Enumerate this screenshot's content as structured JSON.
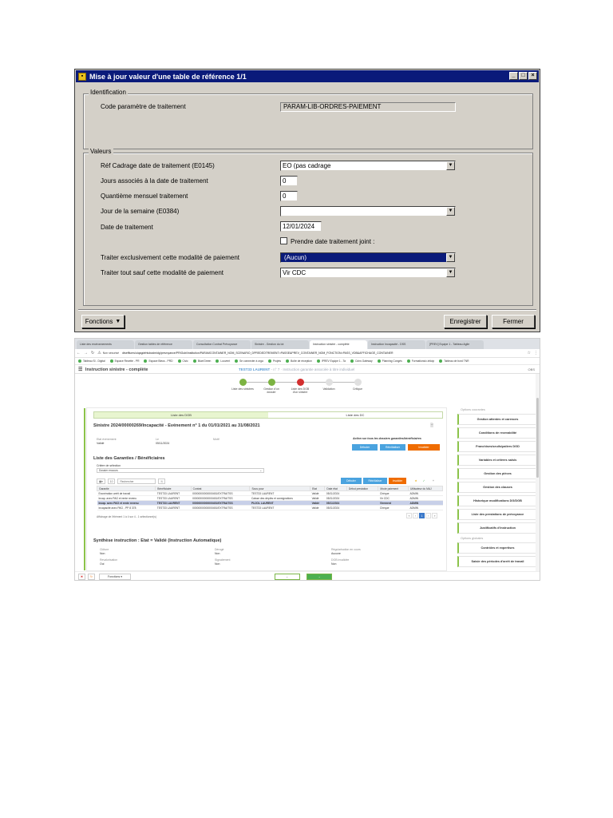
{
  "dialog": {
    "title": "Mise à jour valeur d'une table de référence 1/1",
    "controls": [
      "_",
      "□",
      "×"
    ],
    "identification": {
      "legend": "Identification",
      "code_label": "Code paramètre de traitement",
      "code_value": "PARAM-LIB-ORDRES-PAIEMENT"
    },
    "valeurs": {
      "legend": "Valeurs",
      "fields": [
        {
          "label": "Réf Cadrage date de traitement (E0145)",
          "value": "EO (pas cadrage",
          "kind": "combo"
        },
        {
          "label": "Jours associés à la date de traitement",
          "value": "0",
          "kind": "input"
        },
        {
          "label": "Quantième mensuel traitement",
          "value": "0",
          "kind": "input"
        },
        {
          "label": "Jour de la semaine (E0384)",
          "value": "",
          "kind": "combo"
        },
        {
          "label": "Date de traitement",
          "value": "12/01/2024",
          "kind": "input"
        }
      ],
      "checkbox_label": "Prendre date traitement joint :",
      "modalite_excl_label": "Traiter exclusivement cette modalité de paiement",
      "modalite_excl_value": "(Aucun)",
      "modalite_sauf_label": "Traiter tout sauf cette modalité de paiement",
      "modalite_sauf_value": "Vir CDC"
    },
    "buttons": {
      "fonctions": "Fonctions",
      "enregistrer": "Enregistrer",
      "fermer": "Fermer"
    }
  },
  "browser": {
    "tabs": [
      "Liste des environnements",
      "Gestion tables de référence",
      "Consultation Contrat Prévoyance",
      "Sinistre - Gestion du lot",
      "Instruction sinistre - complète",
      "Instruction Incapacité - DSS",
      "[PREV] Equipe 1 - Tableau Agile"
    ],
    "url": "dtsefflums/uiqagdehtubadmidg/prevoyance/PRIGubi/institution/PARAMCONTAINER_NOM_SCENARIO_DPREDEDTREMENT=PASSE&PREV_CONTAINER_NOM_FONCTION=PASS_VDB&AFFICHAGE_CONTAINER",
    "url_prefix": "Non sécurisé",
    "bookmarks": [
      "Tableau SI - Digital",
      "Espace Recette - PR",
      "Espace Bleus - PRD",
      "Civic",
      "Blue/Green",
      "Loovent",
      "Se connecter à orga",
      "Projets",
      "Boîte de réception",
      "IPREV Equipe 1 - Ta",
      "Cdns Gateway",
      "Planning Congés",
      "Formations/c.inticip",
      "Tableau de bord TNR"
    ]
  },
  "app": {
    "title": "Instruction sinistre - complète",
    "subtitle_name": "TEST33 LAURENT",
    "subtitle_rest": "- n° 7 · Instruction garantie associée à titre individuel",
    "right": "OBS",
    "steps": [
      {
        "label": "Liste des sinistres",
        "color": "#7cb342"
      },
      {
        "label": "Gestion d'un dossier",
        "color": "#7cb342"
      },
      {
        "label": "Liste des DGB d'un sinistre",
        "color": "#d32f2f"
      },
      {
        "label": "Validation",
        "color": "#e0e0e0"
      },
      {
        "label": "Critique",
        "color": "#e0e0e0"
      }
    ],
    "subtabs": [
      "Liste des DGB",
      "Liste des DC"
    ],
    "sinistre_title": "Sinistre 2024/00000269/Incapacité - Evénement n° 1 du 01/01/2021 au 31/08/2021",
    "meta": [
      {
        "label": "Etat événement",
        "value": "Validé"
      },
      {
        "label": "Le",
        "value": "05/11/2024"
      },
      {
        "label": "Motif",
        "value": ""
      }
    ],
    "actions_label": "Action sur tous les dossiers garanties/bénéficiaires",
    "action_buttons": [
      {
        "label": "Débuter",
        "color": "#4aa3df"
      },
      {
        "label": "Réinitialiser",
        "color": "#4aa3df"
      },
      {
        "label": "Invalider",
        "color": "#ef6c00"
      }
    ],
    "garanties_title": "Liste des Garanties / Bénéficiaires",
    "criteria_label": "Critère de sélection",
    "criteria_value": "Dossier encours",
    "page_size": "10",
    "search_placeholder": "Rechercher",
    "table_buttons": [
      {
        "label": "Débuter",
        "color": "#4aa3df"
      },
      {
        "label": "Réinitialiser",
        "color": "#4aa3df"
      },
      {
        "label": "Invalider",
        "color": "#ef6c00"
      }
    ],
    "columns": [
      "Garantie",
      "Bénéficiaire",
      "Contrat",
      "Sous pour",
      "Etat",
      "Date état",
      "Début prestation",
      "Mode paiement",
      "Utilisateur du MAJ"
    ],
    "rows": [
      [
        "Exonération arrêt de travail",
        "TEST33 LAURENT",
        "00000000000000451/EXTRAITSS",
        "TEST33 LAURENT",
        "Validé",
        "05/11/2024",
        "",
        "Chèque",
        "ADMIN"
      ],
      [
        "Incap. avec PAG et rente revenu",
        "TEST33 LAURENT",
        "00000000000000451/EXTRAITSS",
        "Caisse des dépôts et consignations",
        "Validé",
        "05/11/2024",
        "",
        "Vir CDC",
        "ADMIN"
      ],
      [
        "Incap. avec PAG et rente revenu",
        "TEST33 LAURENT",
        "00000000000000451/EXTRAITSS",
        "PUJOL LAURENT",
        "Validé",
        "05/11/2024",
        "",
        "Virement",
        "ADMIN"
      ],
      [
        "Incapacité avec PAG - PP 8 378",
        "TEST33 LAURENT",
        "00000000000000451/EXTRAITSS",
        "TEST33 LAURENT",
        "Validé",
        "05/11/2024",
        "",
        "Chèque",
        "ADMIN"
      ]
    ],
    "selected_row": 2,
    "table_footer": "Affichage de l'élément 1 à 4 sur 4 - 1 sélectionné(s)",
    "pager": [
      "«",
      "‹",
      "1",
      "›",
      "»"
    ],
    "synthese_title": "Synthèse instruction : Etat = Validé (Instruction Automatique)",
    "synthese": [
      {
        "label": "Clôture",
        "value": "Non"
      },
      {
        "label": "Dérogé",
        "value": "Non"
      },
      {
        "label": "Régularisation en cours",
        "value": "Aucune"
      },
      {
        "label": "Revalorisation",
        "value": "Oui"
      },
      {
        "label": "Signalement",
        "value": "Non"
      },
      {
        "label": "DGB invalidée",
        "value": "Non"
      }
    ],
    "side_head_1": "Options courantes",
    "side_items_1": [
      "Gestion attentes et carences",
      "Conditions de recevabilité",
      "Franchises/seuils/paliers DGD",
      "Variables et critères saisis",
      "Gestion des pièces",
      "Gestion des clauses",
      "Historique modifications DG/DGB",
      "Liste des prestations de prévoyance",
      "Justificatifs d'instruction"
    ],
    "side_head_2": "Options globales",
    "side_items_2": [
      "Contrôles et expertises",
      "Saisie des périodes d'arrêt de travail"
    ],
    "footer_buttons": {
      "fonctions": "Fonctions ▾",
      "prev": "←",
      "next": "→"
    }
  }
}
